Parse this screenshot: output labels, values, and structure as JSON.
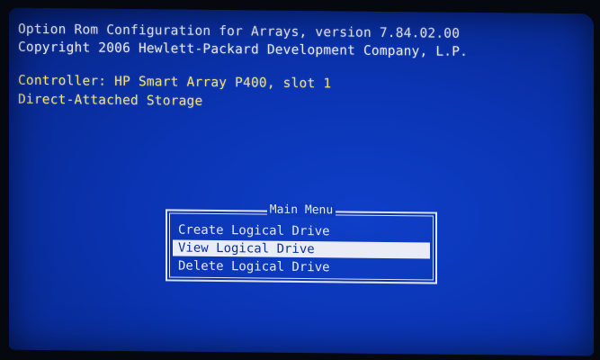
{
  "header": {
    "line1": "Option Rom Configuration for Arrays, version  7.84.02.00",
    "line2": "Copyright 2006 Hewlett-Packard Development Company, L.P.",
    "controller": "Controller: HP Smart Array P400, slot 1",
    "storage": "Direct-Attached Storage"
  },
  "menu": {
    "title": "Main Menu",
    "items": [
      {
        "label": "Create Logical Drive",
        "selected": false
      },
      {
        "label": "View Logical Drive",
        "selected": true
      },
      {
        "label": "Delete Logical Drive",
        "selected": false
      }
    ]
  },
  "colors": {
    "background": "#0a34b3",
    "text_white": "#e6e9f2",
    "text_yellow": "#f1e07a",
    "highlight": "#e9ecf4"
  }
}
